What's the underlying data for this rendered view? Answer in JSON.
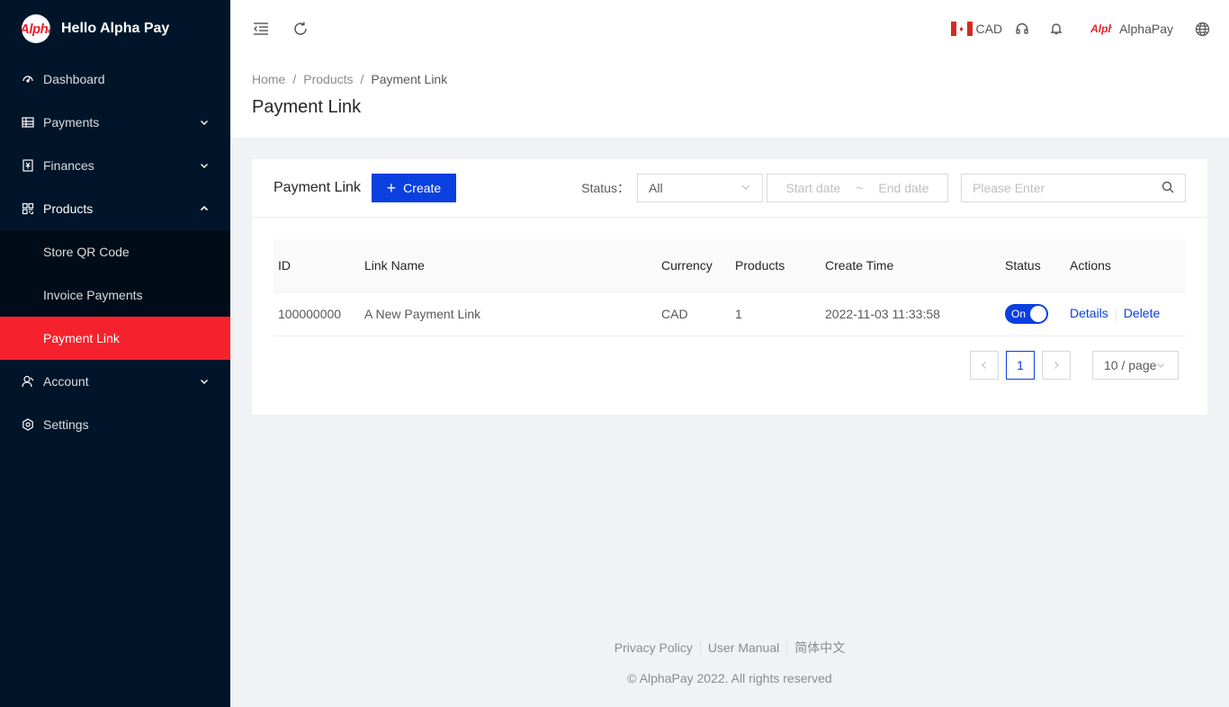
{
  "brand": {
    "logo_text": "Alpha",
    "title": "Hello Alpha Pay"
  },
  "sidebar": {
    "items": [
      {
        "label": "Dashboard",
        "icon": "dashboard-icon"
      },
      {
        "label": "Payments",
        "icon": "payments-icon"
      },
      {
        "label": "Finances",
        "icon": "finances-icon"
      },
      {
        "label": "Products",
        "icon": "products-icon"
      },
      {
        "label": "Account",
        "icon": "account-icon"
      },
      {
        "label": "Settings",
        "icon": "settings-icon"
      }
    ],
    "products_sub": [
      {
        "label": "Store QR Code"
      },
      {
        "label": "Invoice Payments"
      },
      {
        "label": "Payment Link"
      }
    ]
  },
  "header": {
    "currency": "CAD",
    "user_logo": "Alpha",
    "user_name": "AlphaPay"
  },
  "breadcrumb": [
    "Home",
    "Products",
    "Payment Link"
  ],
  "page_title": "Payment Link",
  "card": {
    "title": "Payment Link",
    "create_label": "Create",
    "status_label": "Status：",
    "status_value": "All",
    "start_placeholder": "Start date",
    "range_sep": "~",
    "end_placeholder": "End date",
    "search_placeholder": "Please Enter"
  },
  "table": {
    "columns": [
      "ID",
      "Link Name",
      "Currency",
      "Products",
      "Create Time",
      "Status",
      "Actions"
    ],
    "rows": [
      {
        "id": "100000000",
        "name": "A New Payment Link",
        "currency": "CAD",
        "products": "1",
        "create_time": "2022-11-03 11:33:58",
        "status": "On",
        "action_details": "Details",
        "action_delete": "Delete"
      }
    ]
  },
  "pagination": {
    "prev": "<",
    "current": "1",
    "next": ">",
    "page_size": "10 / page"
  },
  "footer": {
    "privacy": "Privacy Policy",
    "manual": "User Manual",
    "language": "简体中文",
    "copyright": "© AlphaPay 2022. All rights reserved"
  },
  "colors": {
    "sidebar_bg": "#001529",
    "active_menu": "#f5222d",
    "primary": "#0a3fe0"
  }
}
